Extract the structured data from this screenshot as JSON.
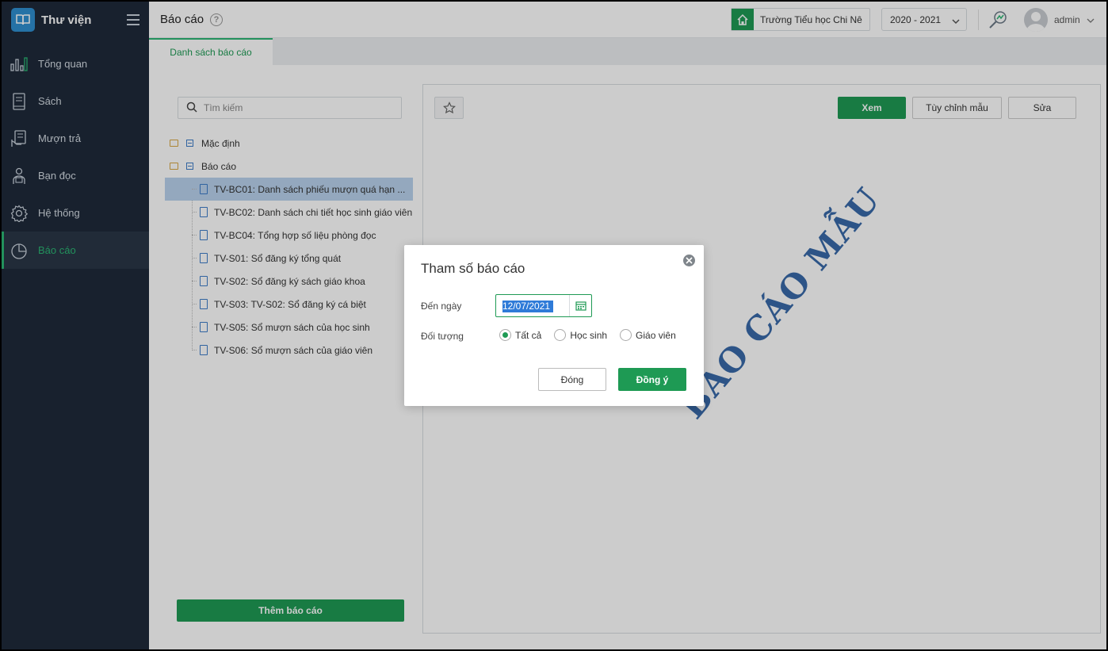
{
  "brand": {
    "title": "Thư viện",
    "logo_icon": "book-logo-icon"
  },
  "sidebar": {
    "items": [
      {
        "label": "Tổng quan",
        "icon": "bar-chart-icon",
        "active": false
      },
      {
        "label": "Sách",
        "icon": "book-icon",
        "active": false
      },
      {
        "label": "Mượn trả",
        "icon": "borrow-icon",
        "active": false
      },
      {
        "label": "Bạn đọc",
        "icon": "reader-icon",
        "active": false
      },
      {
        "label": "Hệ thống",
        "icon": "gear-icon",
        "active": false
      },
      {
        "label": "Báo cáo",
        "icon": "pie-chart-icon",
        "active": true
      }
    ]
  },
  "header": {
    "title": "Báo cáo",
    "help": "?",
    "school": "Trường Tiểu học Chi Nê",
    "year": "2020 - 2021",
    "user": "admin"
  },
  "tabs": [
    {
      "label": "Danh sách báo cáo",
      "active": true
    }
  ],
  "search": {
    "placeholder": "Tìm kiếm",
    "value": ""
  },
  "tree": {
    "folders": [
      {
        "label": "Mặc định"
      },
      {
        "label": "Báo cáo"
      }
    ],
    "reports": [
      {
        "label": "TV-BC01: Danh sách phiếu mượn quá hạn ...",
        "selected": true
      },
      {
        "label": "TV-BC02: Danh sách chi tiết học sinh giáo viên",
        "selected": false
      },
      {
        "label": "TV-BC04: Tổng hợp số liệu phòng đọc",
        "selected": false
      },
      {
        "label": "TV-S01: Sổ đăng ký tổng quát",
        "selected": false
      },
      {
        "label": "TV-S02: Sổ đăng ký sách giáo khoa",
        "selected": false
      },
      {
        "label": "TV-S03: TV-S02: Sổ đăng ký cá biệt",
        "selected": false
      },
      {
        "label": "TV-S05: Sổ mượn sách của học sinh",
        "selected": false
      },
      {
        "label": "TV-S06: Sổ mượn sách của giáo viên",
        "selected": false
      }
    ]
  },
  "add_report_label": "Thêm báo cáo",
  "preview": {
    "view_label": "Xem",
    "custom_label": "Tùy chỉnh mẫu",
    "edit_label": "Sửa",
    "watermark": "BÁO CÁO MẪU"
  },
  "modal": {
    "title": "Tham số báo cáo",
    "date_label": "Đến ngày",
    "date_value": "12/07/2021",
    "target_label": "Đối tượng",
    "options": [
      {
        "label": "Tất cả",
        "checked": true
      },
      {
        "label": "Học sinh",
        "checked": false
      },
      {
        "label": "Giáo viên",
        "checked": false
      }
    ],
    "close_label": "Đóng",
    "ok_label": "Đồng ý"
  },
  "colors": {
    "accent": "#1e9a54",
    "sidebar": "#1e2a3a",
    "selection": "#b9d3ee",
    "watermark": "#2f63a5"
  }
}
